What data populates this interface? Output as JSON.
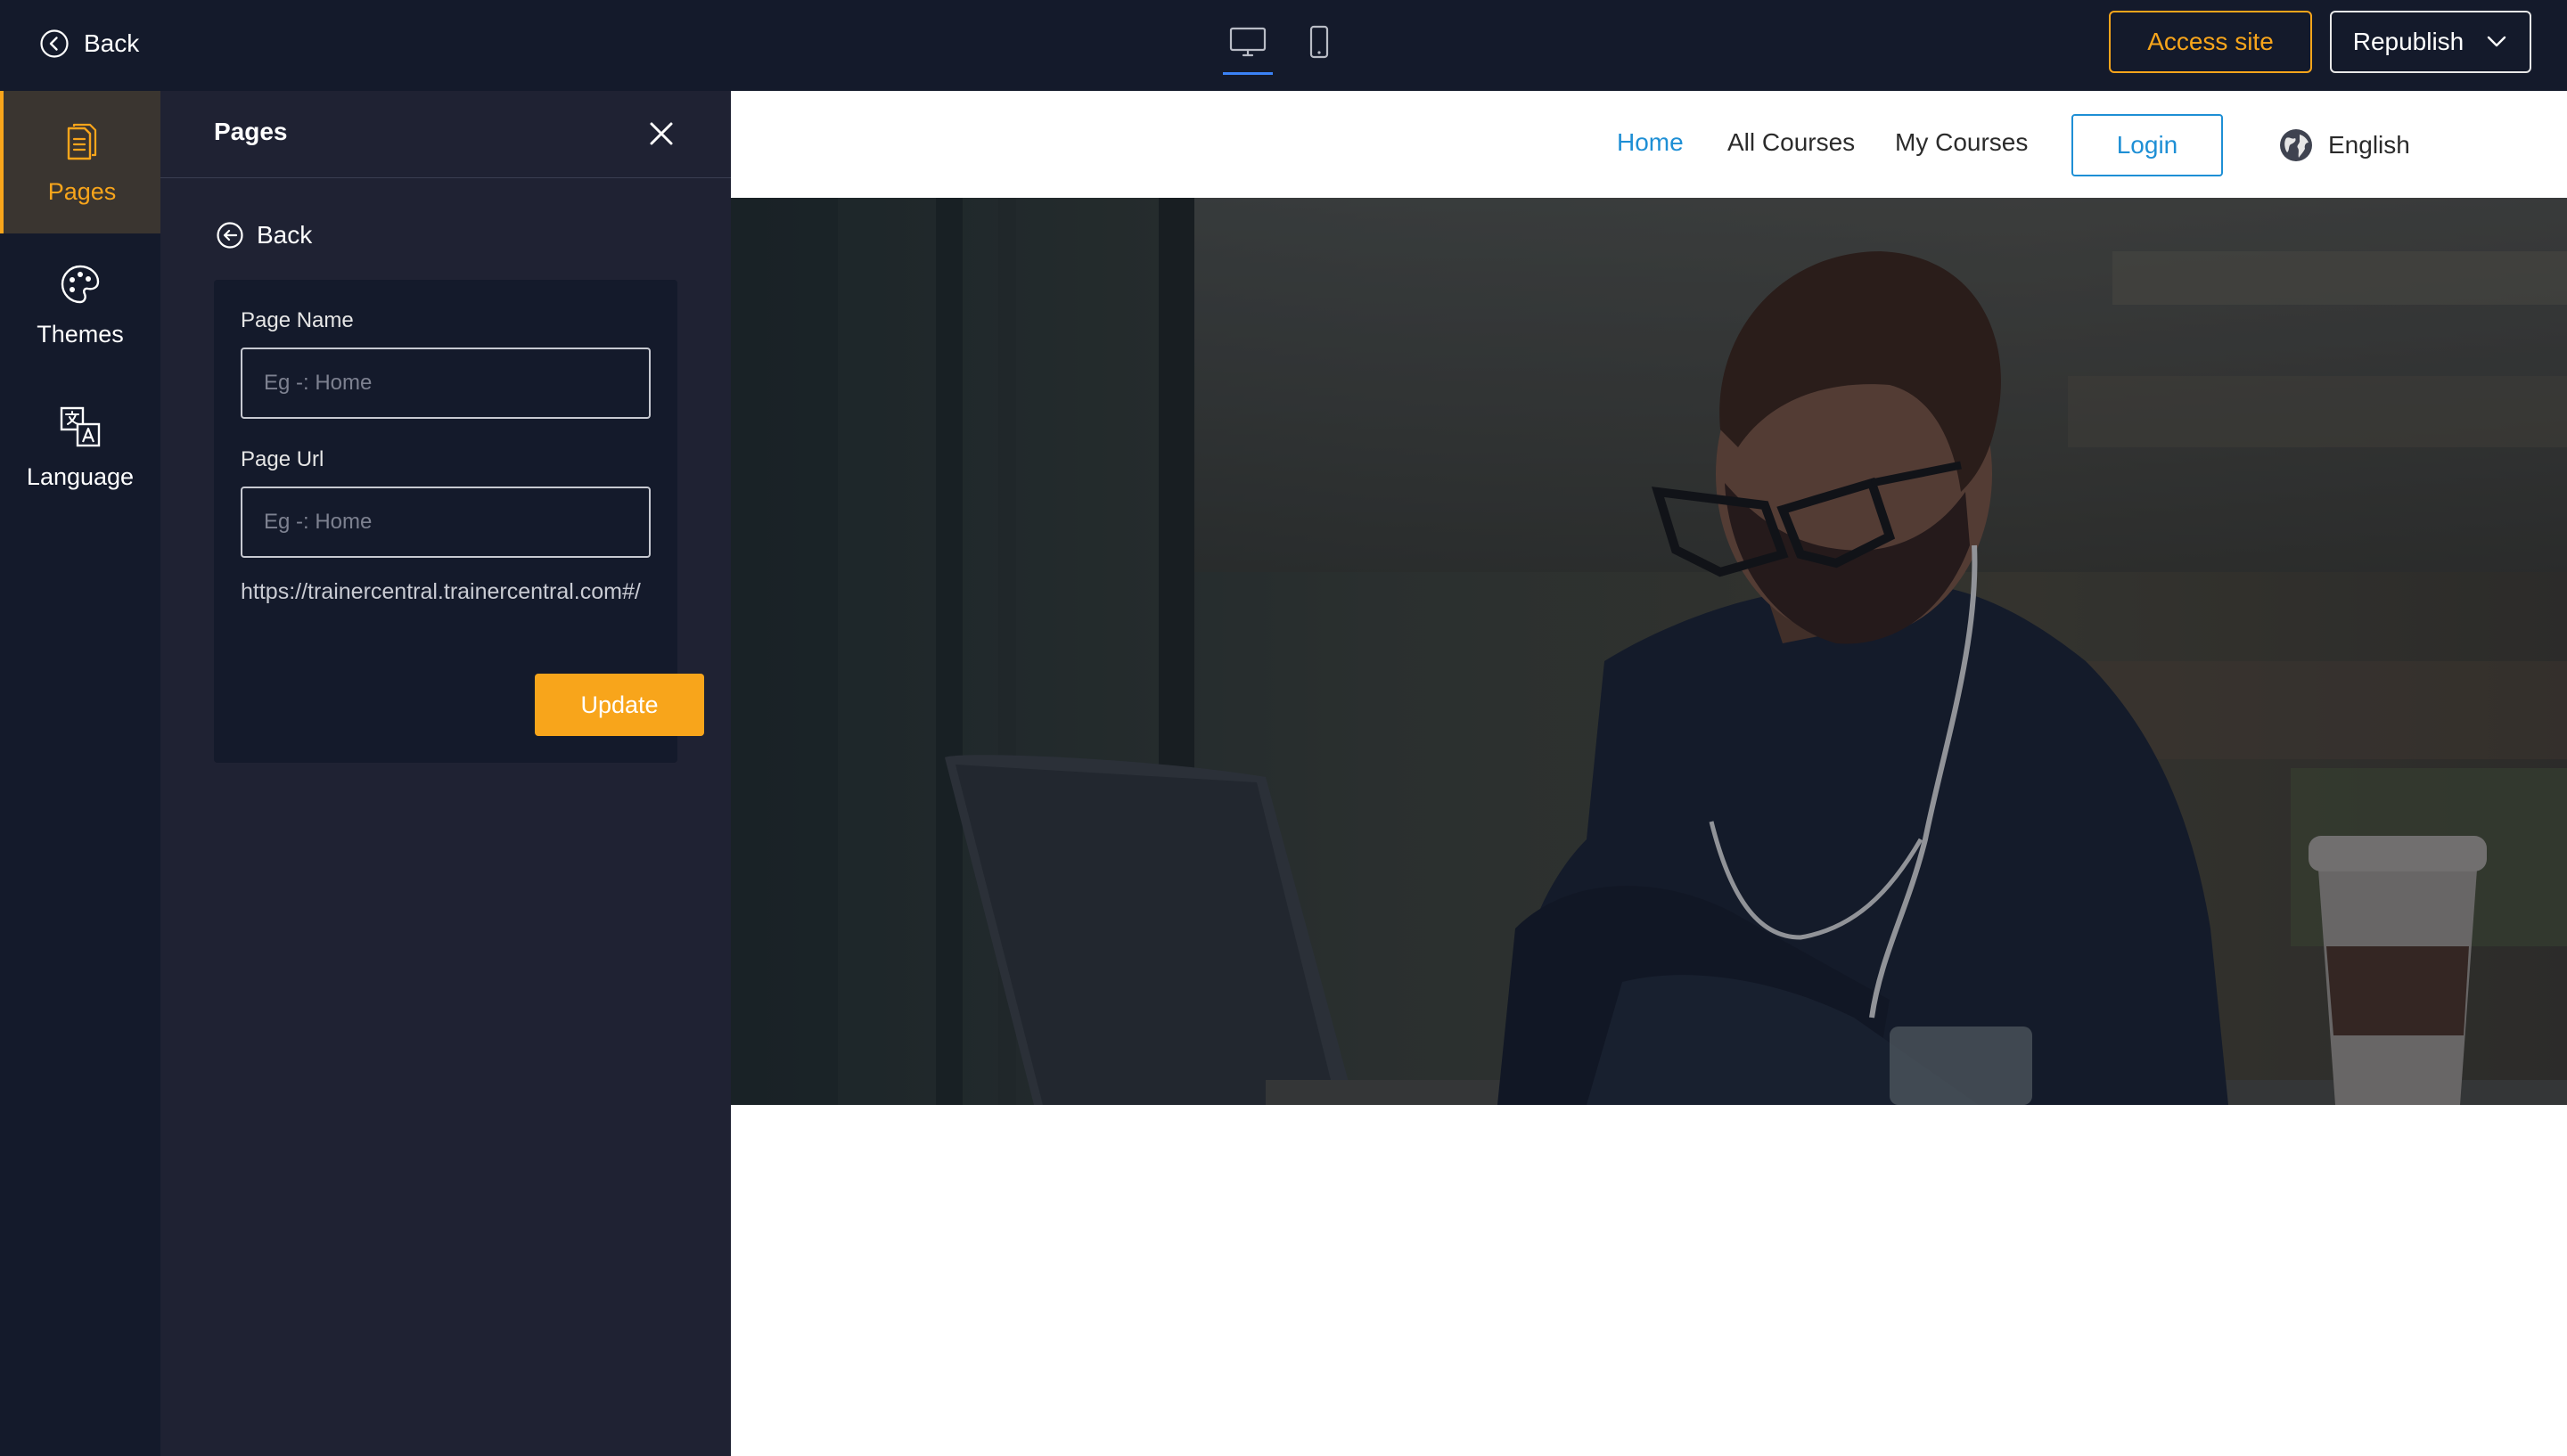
{
  "topbar": {
    "back_label": "Back",
    "access_site_label": "Access site",
    "republish_label": "Republish",
    "accent_color": "#f8a51b"
  },
  "rail": {
    "items": [
      {
        "label": "Pages",
        "icon": "pages-icon",
        "active": true
      },
      {
        "label": "Themes",
        "icon": "palette-icon",
        "active": false
      },
      {
        "label": "Language",
        "icon": "translate-icon",
        "active": false
      }
    ]
  },
  "panel": {
    "title": "Pages",
    "back_label": "Back",
    "page_name_label": "Page Name",
    "page_name_placeholder": "Eg -: Home",
    "page_url_label": "Page Url",
    "page_url_placeholder": "Eg -: Home",
    "url_preview": "https://trainercentral.trainercentral.com#/",
    "update_label": "Update"
  },
  "site": {
    "nav": [
      "Home",
      "All Courses",
      "My Courses"
    ],
    "login_label": "Login",
    "language_label": "English",
    "link_color": "#1e8fd5"
  }
}
